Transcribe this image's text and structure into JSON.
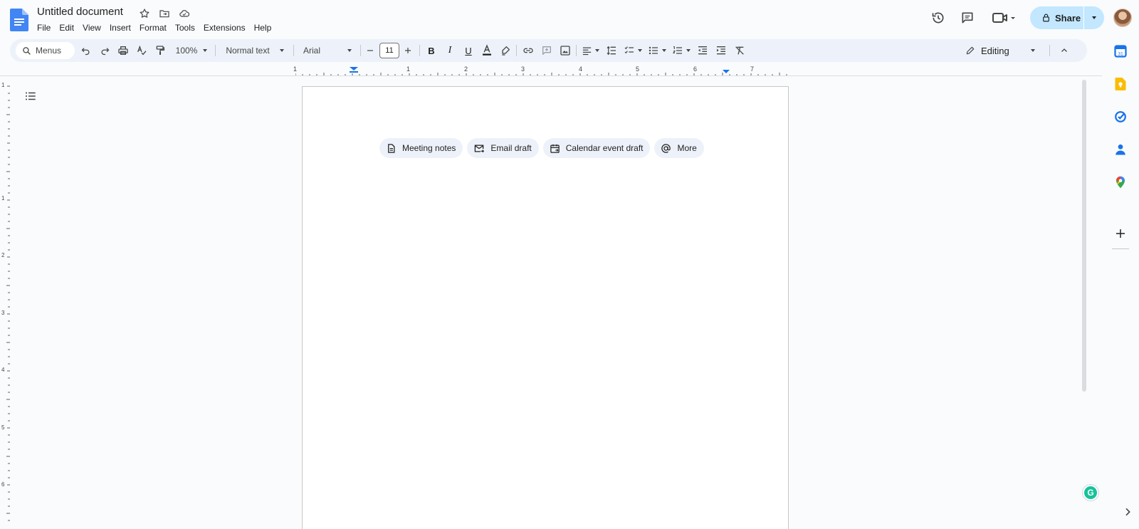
{
  "document": {
    "title": "Untitled document"
  },
  "menu": [
    "File",
    "Edit",
    "View",
    "Insert",
    "Format",
    "Tools",
    "Extensions",
    "Help"
  ],
  "header": {
    "share_label": "Share"
  },
  "toolbar": {
    "search_placeholder": "Menus",
    "zoom": "100%",
    "paragraph_style": "Normal text",
    "font": "Arial",
    "font_size": "11",
    "mode": "Editing"
  },
  "ruler": {
    "horizontal_marks": [
      "1",
      "1",
      "2",
      "3",
      "4",
      "5",
      "6",
      "7"
    ],
    "vertical_marks": [
      "1",
      "1",
      "2",
      "3",
      "4",
      "5",
      "6"
    ]
  },
  "chips": [
    {
      "label": "Meeting notes",
      "icon": "document-icon"
    },
    {
      "label": "Email draft",
      "icon": "email-draft-icon"
    },
    {
      "label": "Calendar event draft",
      "icon": "calendar-event-icon"
    },
    {
      "label": "More",
      "icon": "at-sign-icon"
    }
  ],
  "side_panel": [
    "calendar-icon",
    "keep-icon",
    "tasks-icon",
    "contacts-icon",
    "maps-icon",
    "add-icon"
  ],
  "colors": {
    "accent": "#1a73e8",
    "share_bg": "#c2e7ff",
    "toolbar_bg": "#edf2fa"
  }
}
